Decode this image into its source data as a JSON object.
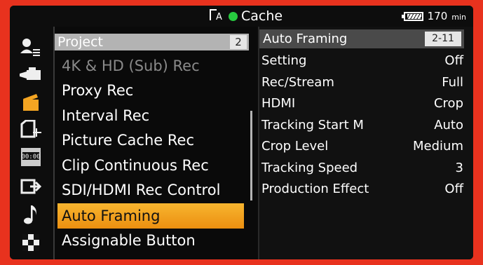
{
  "status": {
    "center_label": "Cache",
    "rec_dot_color": "#27c93f",
    "battery_minutes": "170",
    "battery_unit": "min"
  },
  "sidebar": {
    "icons": [
      "user-menu-icon",
      "camera-icon",
      "clapperboard-icon",
      "card-icon",
      "timecode-icon",
      "output-icon",
      "audio-icon",
      "checker-icon"
    ]
  },
  "list": {
    "header_title": "Project",
    "header_badge": "2",
    "items": [
      {
        "label": "4K & HD (Sub) Rec"
      },
      {
        "label": "Proxy Rec"
      },
      {
        "label": "Interval Rec"
      },
      {
        "label": "Picture Cache Rec"
      },
      {
        "label": "Clip Continuous Rec"
      },
      {
        "label": "SDI/HDMI Rec Control"
      },
      {
        "label": "Auto Framing"
      },
      {
        "label": "Assignable Button"
      }
    ],
    "selected_index": 6
  },
  "detail": {
    "title": "Auto Framing",
    "badge": "2-11",
    "rows": [
      {
        "key": "Setting",
        "value": "Off"
      },
      {
        "key": "Rec/Stream",
        "value": "Full"
      },
      {
        "key": "HDMI",
        "value": "Crop"
      },
      {
        "key": "Tracking Start M",
        "value": "Auto"
      },
      {
        "key": "Crop Level",
        "value": "Medium"
      },
      {
        "key": "Tracking Speed",
        "value": "3"
      },
      {
        "key": "Production Effect",
        "value": "Off"
      }
    ]
  },
  "colors": {
    "accent": "#f0a020",
    "frame": "#e8321e"
  }
}
